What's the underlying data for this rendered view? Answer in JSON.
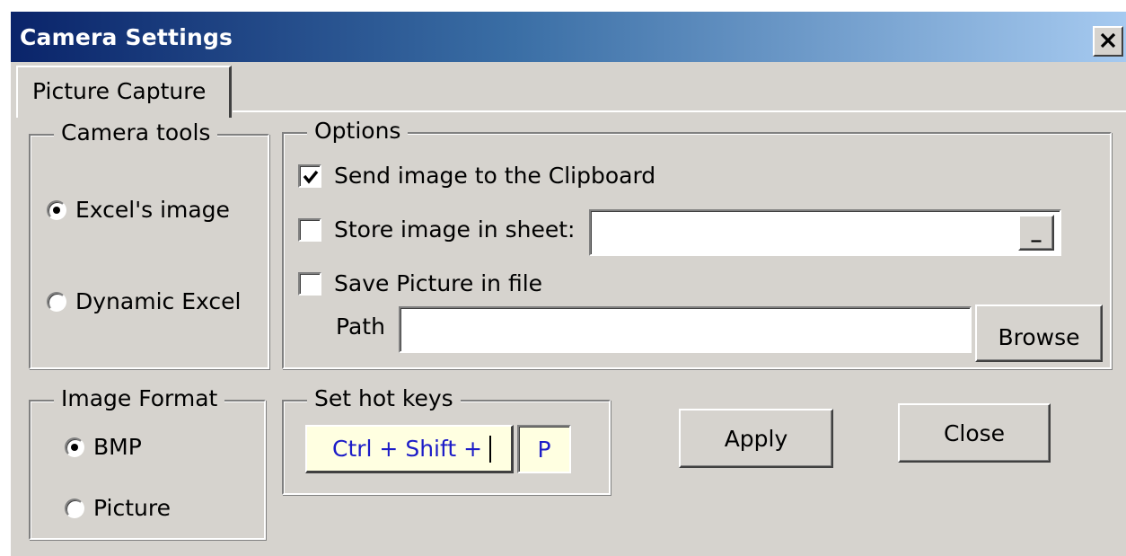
{
  "window": {
    "title": "Camera Settings",
    "close_glyph": "✕"
  },
  "tabs": [
    {
      "label": "Picture Capture",
      "active": true
    }
  ],
  "camera_tools": {
    "legend": "Camera tools",
    "options": [
      {
        "label": "Excel's image",
        "selected": true
      },
      {
        "label": "Dynamic Excel",
        "selected": false
      }
    ]
  },
  "options_group": {
    "legend": "Options",
    "send_clipboard": {
      "label": "Send image to the Clipboard",
      "checked": true
    },
    "store_sheet": {
      "label": "Store image in sheet:",
      "checked": false,
      "value": "",
      "button_label": "_"
    },
    "save_file": {
      "label": "Save Picture in file",
      "checked": false
    },
    "path": {
      "label": "Path",
      "value": ""
    },
    "browse_label": "Browse"
  },
  "image_format": {
    "legend": "Image Format",
    "options": [
      {
        "label": "BMP",
        "selected": true
      },
      {
        "label": "Picture",
        "selected": false
      }
    ]
  },
  "hot_keys": {
    "legend": "Set hot keys",
    "prefix": "Ctrl + Shift +",
    "key": "P"
  },
  "actions": {
    "apply_label": "Apply",
    "close_label": "Close"
  },
  "colors": {
    "dialog_bg": "#d6d3ce",
    "title_start": "#0a246a",
    "title_end": "#a6caf0",
    "hotkey_bg": "#ffffe1",
    "hotkey_text": "#1c1cc8"
  }
}
